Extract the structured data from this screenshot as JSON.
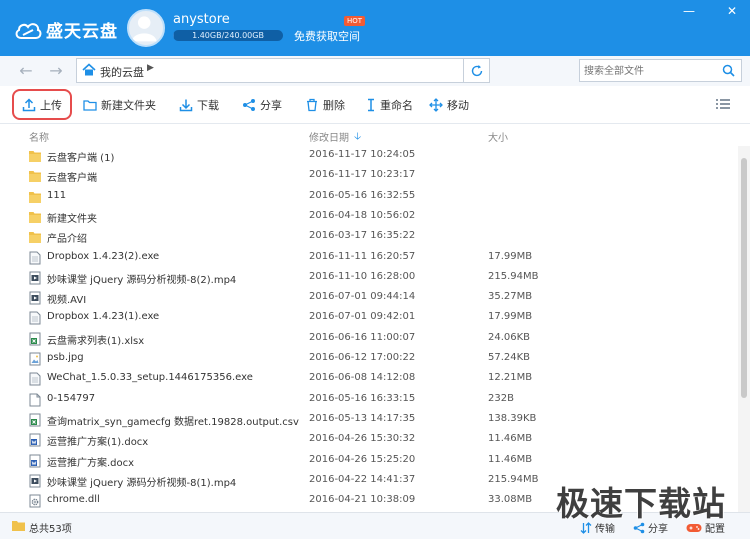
{
  "app": {
    "logo_text": "盛天云盘",
    "username": "anystore",
    "quota_text": "1.40GB/240.00GB",
    "quota_fraction": 0.006,
    "free_space_label": "免费获取空间",
    "hot_badge": "HOT",
    "brand_color": "#1e8fe6"
  },
  "window": {
    "minimize": "—",
    "close": "✕"
  },
  "nav": {
    "back": "←",
    "forward": "→",
    "path": "我的云盘",
    "path_arrow": "▶",
    "search_placeholder": "搜索全部文件"
  },
  "toolbar": {
    "upload": "上传",
    "new_folder": "新建文件夹",
    "download": "下载",
    "share": "分享",
    "delete": "删除",
    "rename": "重命名",
    "move": "移动"
  },
  "columns": {
    "name": "名称",
    "date": "修改日期",
    "date_sort": "🡣",
    "size": "大小"
  },
  "files": [
    {
      "icon": "folder",
      "name": "云盘客户端 (1)",
      "date": "2016-11-17 10:24:05",
      "size": ""
    },
    {
      "icon": "folder",
      "name": "云盘客户端",
      "date": "2016-11-17 10:23:17",
      "size": ""
    },
    {
      "icon": "folder",
      "name": "111",
      "date": "2016-05-16 16:32:55",
      "size": ""
    },
    {
      "icon": "folder",
      "name": "新建文件夹",
      "date": "2016-04-18 10:56:02",
      "size": ""
    },
    {
      "icon": "folder",
      "name": "产品介绍",
      "date": "2016-03-17 16:35:22",
      "size": ""
    },
    {
      "icon": "file",
      "name": "Dropbox 1.4.23(2).exe",
      "date": "2016-11-11 16:20:57",
      "size": "17.99MB"
    },
    {
      "icon": "video",
      "name": "妙味课堂 jQuery 源码分析视频-8(2).mp4",
      "date": "2016-11-10 16:28:00",
      "size": "215.94MB"
    },
    {
      "icon": "video",
      "name": "视频.AVI",
      "date": "2016-07-01 09:44:14",
      "size": "35.27MB"
    },
    {
      "icon": "file",
      "name": "Dropbox 1.4.23(1).exe",
      "date": "2016-07-01 09:42:01",
      "size": "17.99MB"
    },
    {
      "icon": "excel",
      "name": "云盘需求列表(1).xlsx",
      "date": "2016-06-16 11:00:07",
      "size": "24.06KB"
    },
    {
      "icon": "image",
      "name": "psb.jpg",
      "date": "2016-06-12 17:00:22",
      "size": "57.24KB"
    },
    {
      "icon": "file",
      "name": "WeChat_1.5.0.33_setup.1446175356.exe",
      "date": "2016-06-08 14:12:08",
      "size": "12.21MB"
    },
    {
      "icon": "blank",
      "name": "0-154797",
      "date": "2016-05-16 16:33:15",
      "size": "232B"
    },
    {
      "icon": "excel",
      "name": "查询matrix_syn_gamecfg 数据ret.19828.output.csv",
      "date": "2016-05-13 14:17:35",
      "size": "138.39KB"
    },
    {
      "icon": "word",
      "name": "运营推广方案(1).docx",
      "date": "2016-04-26 15:30:32",
      "size": "11.46MB"
    },
    {
      "icon": "word",
      "name": "运营推广方案.docx",
      "date": "2016-04-26 15:25:20",
      "size": "11.46MB"
    },
    {
      "icon": "video",
      "name": "妙味课堂 jQuery 源码分析视频-8(1).mp4",
      "date": "2016-04-22 14:41:37",
      "size": "215.94MB"
    },
    {
      "icon": "gear",
      "name": "chrome.dll",
      "date": "2016-04-21 10:38:09",
      "size": "33.08MB"
    }
  ],
  "status": {
    "count": "总共53项",
    "transfer": "传输",
    "share": "分享",
    "settings": "配置"
  },
  "watermark": "极速下载站"
}
